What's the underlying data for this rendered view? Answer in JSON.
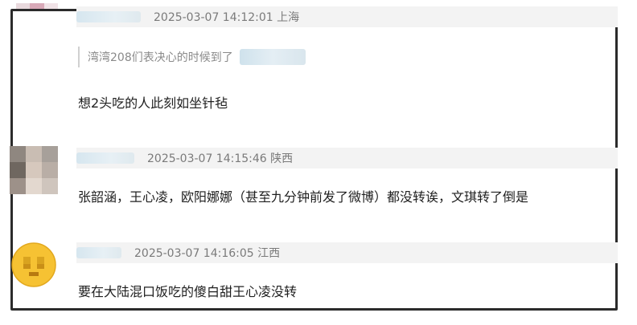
{
  "comments": [
    {
      "meta": "2025-03-07 14:12:01 上海",
      "quote": "湾湾208们表决心的时候到了",
      "text": "想2头吃的人此刻如坐针毡"
    },
    {
      "meta": "2025-03-07 14:15:46 陕西",
      "text": "张韶涵，王心凌，欧阳娜娜（甚至九分钟前发了微博）都没转诶，文琪转了倒是"
    },
    {
      "meta": "2025-03-07 14:16:05 江西",
      "text": "要在大陆混口饭吃的傻白甜王心凌没转"
    }
  ],
  "colors": {
    "frame_border": "#2b2b2b",
    "meta_bg": "#f3f3f3",
    "meta_text": "#7a7a7a",
    "comment_text": "#1f1f1f",
    "emoji_yellow": "#f6c233"
  },
  "icons": {
    "avatar_1": "pixelated-pink-avatar",
    "avatar_2": "pixelated-photo-avatar",
    "avatar_3": "emoji-avatar"
  }
}
